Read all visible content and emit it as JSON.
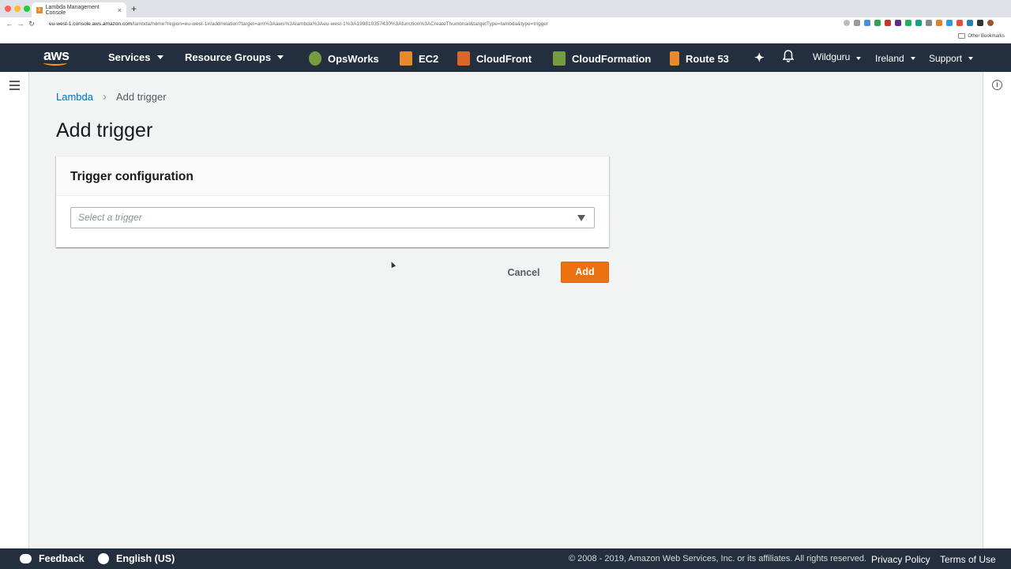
{
  "browser": {
    "tab_title": "Lambda Management Console",
    "tab_close": "×",
    "new_tab": "+",
    "url_host": "eu-west-1.console.aws.amazon.com",
    "url_path": "/lambda/home?region=eu-west-1#/add/relation?target=arn%3Aaws%3Alambda%3Aeu-west-1%3A199810357430%3Afunction%3ACreateThumbnail&targetType=lambda&type=trigger",
    "other_bookmarks": "Other Bookmarks",
    "back": "←",
    "forward": "→",
    "reload": "↻"
  },
  "nav": {
    "logo": "aws",
    "services": "Services",
    "resource_groups": "Resource Groups",
    "opsworks": "OpsWorks",
    "ec2": "EC2",
    "cloudfront": "CloudFront",
    "cloudformation": "CloudFormation",
    "route53": "Route 53",
    "account": "Wildguru",
    "region": "Ireland",
    "support": "Support"
  },
  "breadcrumb": {
    "parent": "Lambda",
    "separator": ">",
    "current": "Add trigger"
  },
  "page": {
    "title": "Add trigger",
    "panel_title": "Trigger configuration",
    "select_placeholder": "Select a trigger",
    "cancel": "Cancel",
    "add": "Add"
  },
  "footer": {
    "feedback": "Feedback",
    "language": "English (US)",
    "copyright": "© 2008 - 2019, Amazon Web Services, Inc. or its affiliates. All rights reserved.",
    "privacy": "Privacy Policy",
    "terms": "Terms of Use"
  },
  "colors": {
    "nav_bg": "#232f3e",
    "accent": "#ec7211",
    "link": "#0073bb",
    "page_bg": "#f2f3f3"
  }
}
